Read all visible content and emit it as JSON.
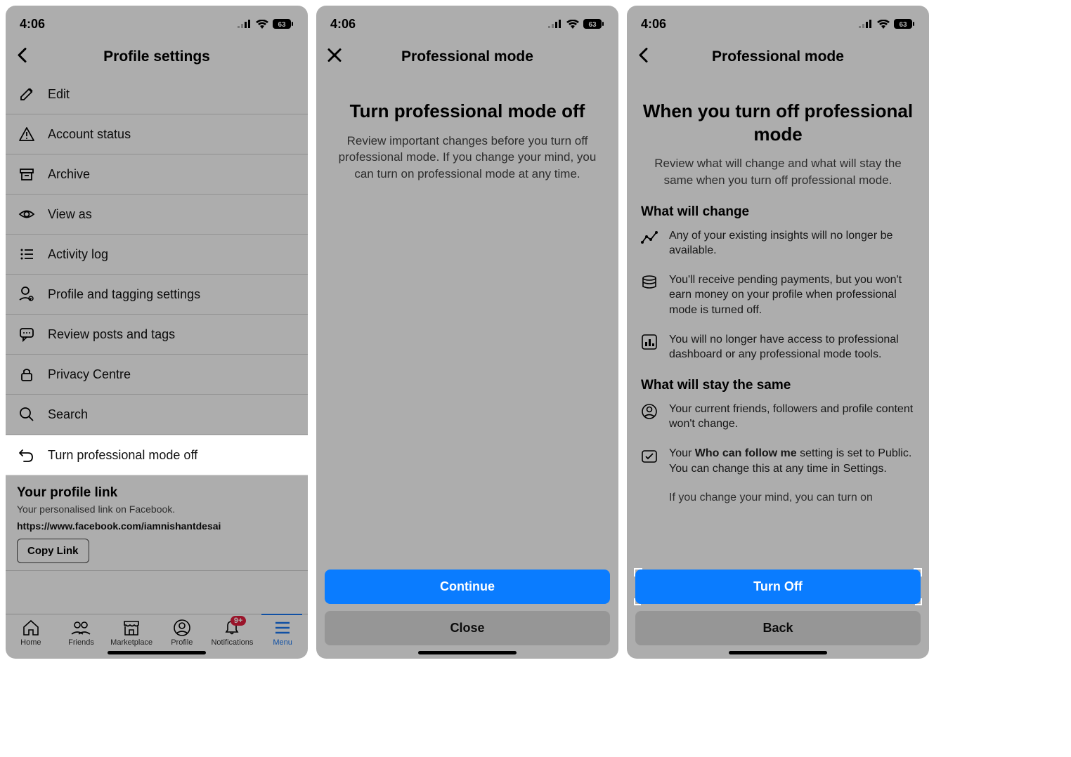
{
  "status": {
    "time": "4:06",
    "battery": "63"
  },
  "screen1": {
    "title": "Profile settings",
    "items": [
      "Edit",
      "Account status",
      "Archive",
      "View as",
      "Activity log",
      "Profile and tagging settings",
      "Review posts and tags",
      "Privacy Centre",
      "Search"
    ],
    "highlight_item": "Turn professional mode off",
    "profile_link_heading": "Your profile link",
    "profile_link_sub": "Your personalised link on Facebook.",
    "profile_link_url": "https://www.facebook.com/iamnishantdesai",
    "copy_label": "Copy Link",
    "tabs": {
      "home": "Home",
      "friends": "Friends",
      "marketplace": "Marketplace",
      "profile": "Profile",
      "notifications": "Notifications",
      "menu": "Menu",
      "notif_badge": "9+"
    }
  },
  "screen2": {
    "title": "Professional mode",
    "heading": "Turn professional mode off",
    "description": "Review important changes before you turn off professional mode. If you change your mind, you can turn on professional mode at any time.",
    "primary": "Continue",
    "secondary": "Close"
  },
  "screen3": {
    "title": "Professional mode",
    "heading": "When you turn off professional mode",
    "description": "Review what will change and what will stay the same when you turn off professional mode.",
    "change_heading": "What will change",
    "change1": "Any of your existing insights will no longer be available.",
    "change2": "You'll receive pending payments, but you won't earn money on your profile when professional mode is turned off.",
    "change3": "You will no longer have access to professional dashboard or any professional mode tools.",
    "same_heading": "What will stay the same",
    "same1": "Your current friends, followers and profile content won't change.",
    "same2_pre": "Your ",
    "same2_bold": "Who can follow me",
    "same2_post": " setting is set to Public. You can change this at any time in Settings.",
    "same3_partial": "If you change your mind, you can turn on",
    "primary": "Turn Off",
    "secondary": "Back"
  }
}
